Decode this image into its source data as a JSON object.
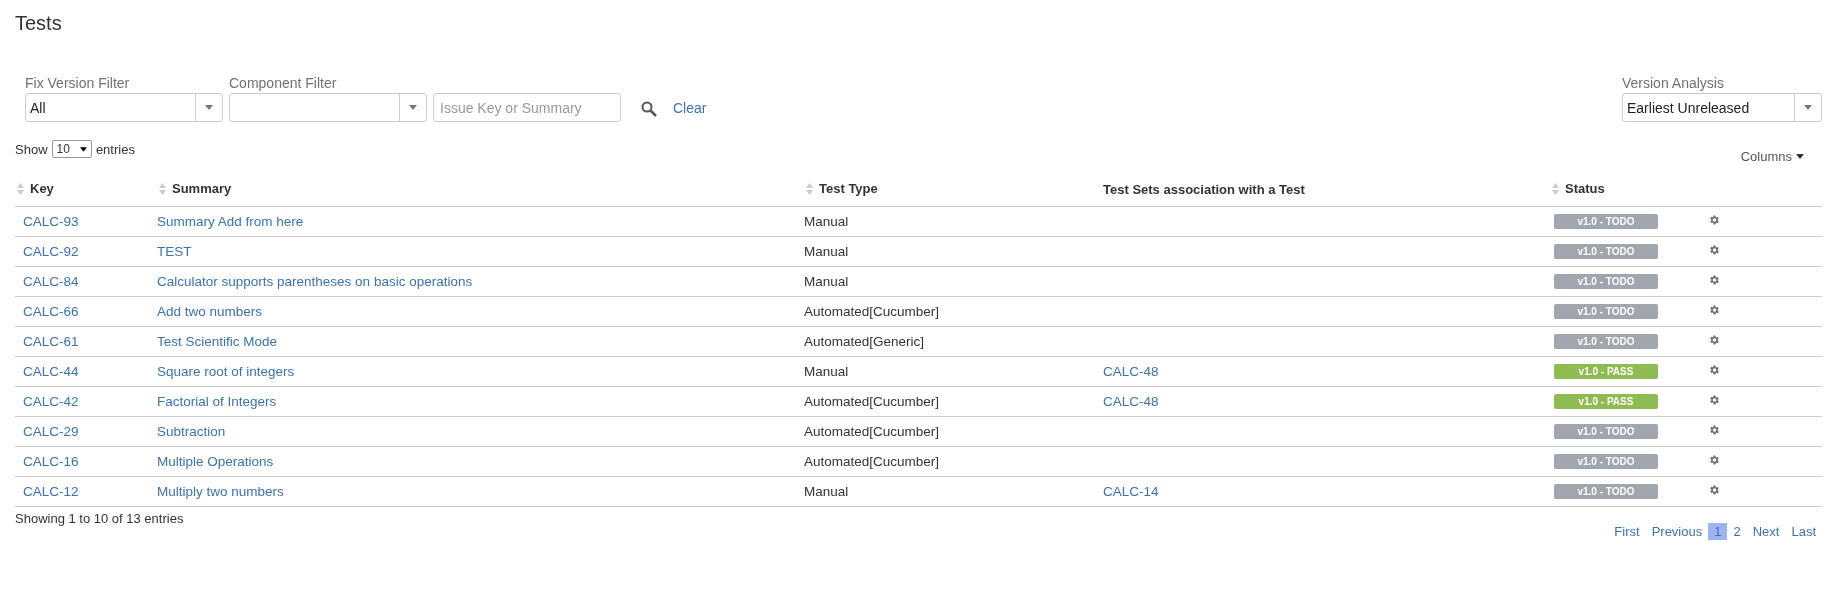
{
  "title": "Tests",
  "filters": [
    {
      "label": "Fix Version Filter",
      "value": "All"
    },
    {
      "label": "Component Filter"
    }
  ],
  "search": {
    "placeholder": "Issue Key or Summary"
  },
  "clear": "Clear",
  "version_analysis": {
    "label": "Version Analysis",
    "value": "Earliest Unreleased"
  },
  "length": {
    "before": "Show",
    "value": "10",
    "after": "entries"
  },
  "columns_button": "Columns",
  "table": {
    "columns": [
      {
        "label": "Key",
        "sortable": true
      },
      {
        "label": "Summary",
        "sortable": true
      },
      {
        "label": "Test Type",
        "sortable": true
      },
      {
        "label": "Test Sets association with a Test",
        "sortable": false
      },
      {
        "label": "Status",
        "sortable": true
      }
    ],
    "rows": [
      {
        "key": "CALC-93",
        "summary": "Summary Add from here",
        "type": "Manual",
        "status": "v1.0 - TODO",
        "color": "#a1a5ad"
      },
      {
        "key": "CALC-92",
        "summary": "TEST",
        "type": "Manual",
        "status": "v1.0 - TODO",
        "color": "#a1a5ad"
      },
      {
        "key": "CALC-84",
        "summary": "Calculator supports parentheses on basic operations",
        "type": "Manual",
        "status": "v1.0 - TODO",
        "color": "#a1a5ad"
      },
      {
        "key": "CALC-66",
        "summary": "Add two numbers",
        "type": "Automated[Cucumber]",
        "status": "v1.0 - TODO",
        "color": "#a1a5ad"
      },
      {
        "key": "CALC-61",
        "summary": "Test Scientific Mode",
        "type": "Automated[Generic]",
        "status": "v1.0 - TODO",
        "color": "#a1a5ad"
      },
      {
        "key": "CALC-44",
        "summary": "Square root of integers",
        "type": "Manual",
        "sets": "CALC-48",
        "status": "v1.0 - PASS",
        "color": "#8fbc52"
      },
      {
        "key": "CALC-42",
        "summary": "Factorial of Integers",
        "type": "Automated[Cucumber]",
        "sets": "CALC-48",
        "status": "v1.0 - PASS",
        "color": "#8fbc52"
      },
      {
        "key": "CALC-29",
        "summary": "Subtraction",
        "type": "Automated[Cucumber]",
        "status": "v1.0 - TODO",
        "color": "#a1a5ad"
      },
      {
        "key": "CALC-16",
        "summary": "Multiple Operations",
        "type": "Automated[Cucumber]",
        "status": "v1.0 - TODO",
        "color": "#a1a5ad"
      },
      {
        "key": "CALC-12",
        "summary": "Multiply two numbers",
        "type": "Manual",
        "sets": "CALC-14",
        "status": "v1.0 - TODO",
        "color": "#a1a5ad"
      }
    ]
  },
  "info": "Showing 1 to 10 of 13 entries",
  "pagination": [
    {
      "label": "First",
      "selected": false
    },
    {
      "label": "Previous",
      "selected": false
    },
    {
      "label": "1",
      "selected": true
    },
    {
      "label": "2",
      "selected": false
    },
    {
      "label": "Next",
      "selected": false
    },
    {
      "label": "Last",
      "selected": false
    }
  ]
}
